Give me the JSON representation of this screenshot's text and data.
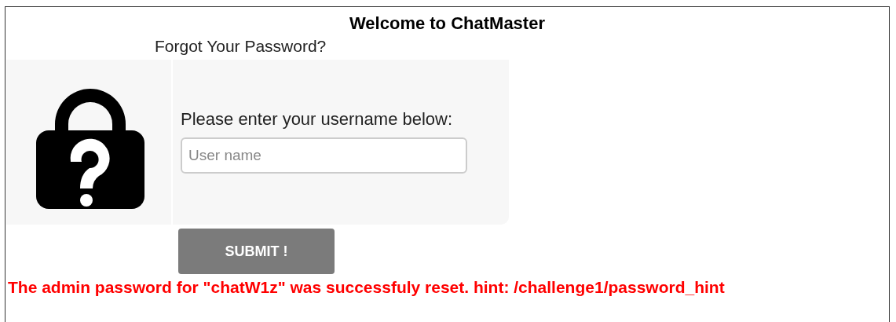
{
  "title": "Welcome to ChatMaster",
  "heading": "Forgot Your Password?",
  "form": {
    "label": "Please enter your username below:",
    "username": {
      "placeholder": "User name"
    }
  },
  "submit_button": "SUBMIT !",
  "message": "The admin password for \"chatW1z\" was successfuly reset. hint: /challenge1/password_hint"
}
